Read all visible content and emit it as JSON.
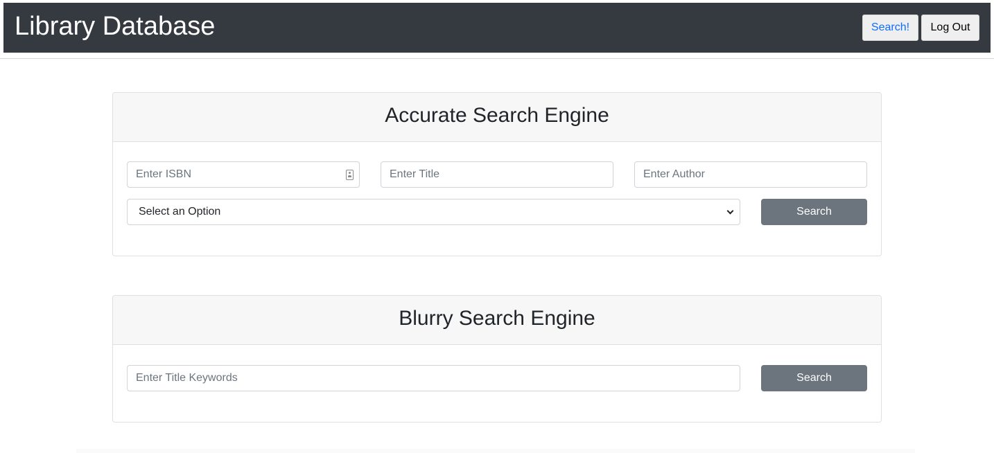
{
  "navbar": {
    "brand": "Library Database",
    "search_label": "Search!",
    "logout_label": "Log Out"
  },
  "accurate": {
    "title": "Accurate Search Engine",
    "isbn_placeholder": "Enter ISBN",
    "title_placeholder": "Enter Title",
    "author_placeholder": "Enter Author",
    "select_value": "Select an Option",
    "search_label": "Search"
  },
  "blurry": {
    "title": "Blurry Search Engine",
    "keywords_placeholder": "Enter Title Keywords",
    "search_label": "Search"
  },
  "colors": {
    "navbar_bg": "#343a40",
    "search_link": "#0d6efd",
    "button_secondary": "#6c757d"
  },
  "icons": {
    "isbn_field": "contact-card-icon",
    "select": "chevron-down-icon"
  }
}
